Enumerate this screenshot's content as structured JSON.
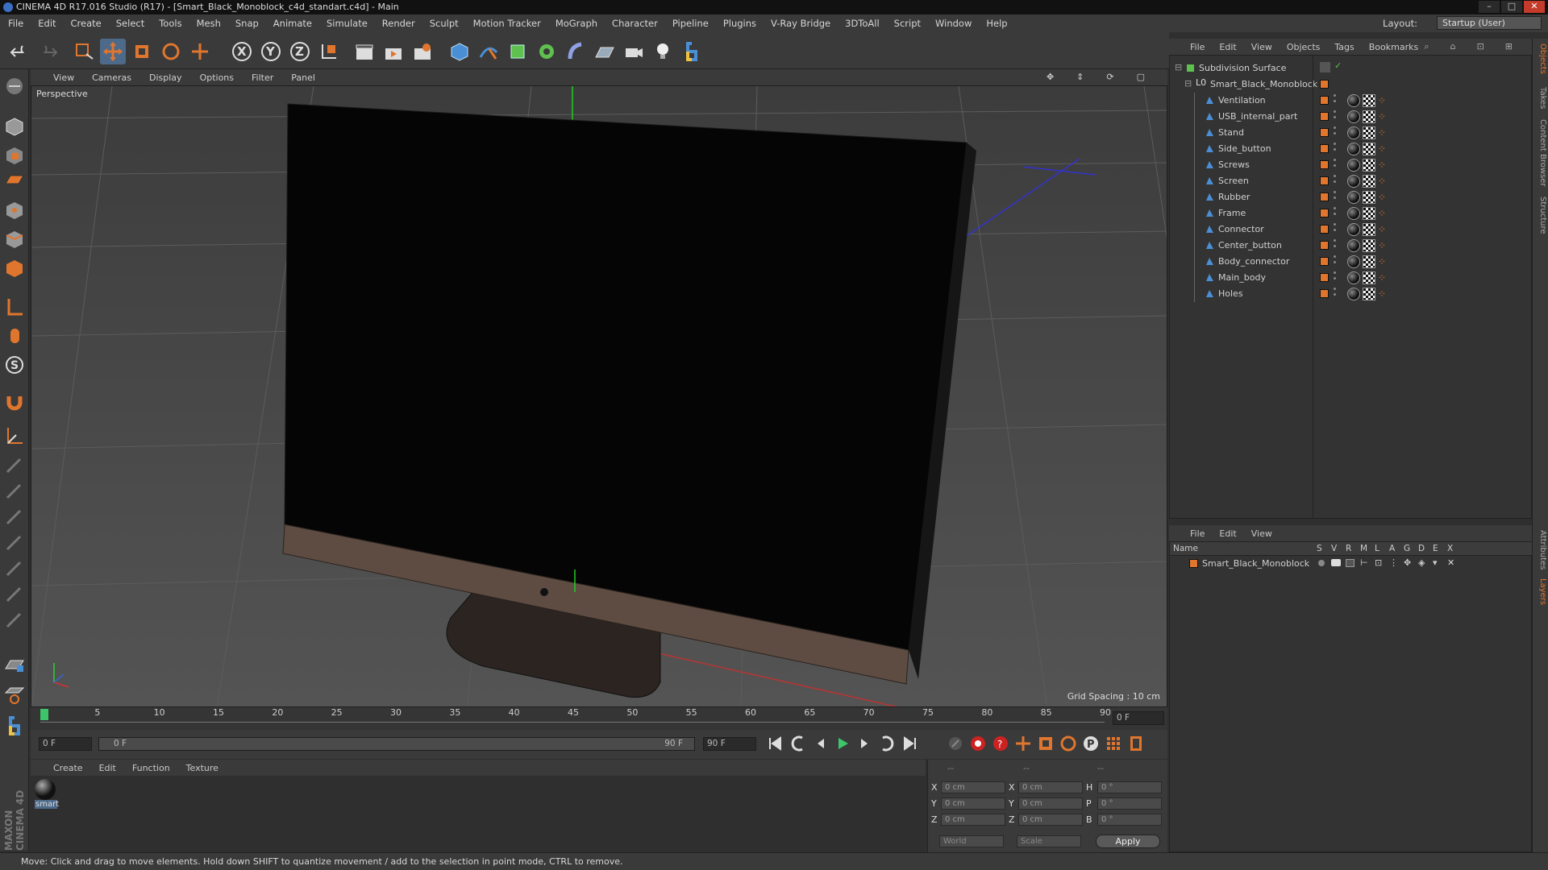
{
  "window": {
    "title": "CINEMA 4D R17.016 Studio (R17) - [Smart_Black_Monoblock_c4d_standart.c4d] - Main"
  },
  "menu": [
    "File",
    "Edit",
    "Create",
    "Select",
    "Tools",
    "Mesh",
    "Snap",
    "Animate",
    "Simulate",
    "Render",
    "Sculpt",
    "Motion Tracker",
    "MoGraph",
    "Character",
    "Pipeline",
    "Plugins",
    "V-Ray Bridge",
    "3DToAll",
    "Script",
    "Window",
    "Help"
  ],
  "layout": {
    "label": "Layout:",
    "value": "Startup (User)"
  },
  "toolbar": {
    "axis_x": "X",
    "axis_y": "Y",
    "axis_z": "Z"
  },
  "viewport": {
    "menu": [
      "View",
      "Cameras",
      "Display",
      "Options",
      "Filter",
      "Panel"
    ],
    "label": "Perspective",
    "grid_spacing": "Grid Spacing : 10 cm"
  },
  "timeline": {
    "ticks": [
      "0",
      "5",
      "10",
      "15",
      "20",
      "25",
      "30",
      "35",
      "40",
      "45",
      "50",
      "55",
      "60",
      "65",
      "70",
      "75",
      "80",
      "85",
      "90"
    ],
    "current_frame": "0 F",
    "start_frame": "0 F",
    "range_start": "0 F",
    "range_end": "90 F",
    "end_frame": "90 F"
  },
  "material_manager": {
    "menu": [
      "Create",
      "Edit",
      "Function",
      "Texture"
    ],
    "materials": [
      {
        "name": "smart"
      }
    ]
  },
  "coordinates": {
    "headers": [
      "--",
      "--",
      "--"
    ],
    "rows": [
      {
        "axis": "X",
        "pos": "0 cm",
        "size_axis": "X",
        "size": "0 cm",
        "rot_axis": "H",
        "rot": "0 °"
      },
      {
        "axis": "Y",
        "pos": "0 cm",
        "size_axis": "Y",
        "size": "0 cm",
        "rot_axis": "P",
        "rot": "0 °"
      },
      {
        "axis": "Z",
        "pos": "0 cm",
        "size_axis": "Z",
        "size": "0 cm",
        "rot_axis": "B",
        "rot": "0 °"
      }
    ],
    "mode": "World",
    "scale": "Scale",
    "apply": "Apply"
  },
  "object_manager": {
    "menu": [
      "File",
      "Edit",
      "View",
      "Objects",
      "Tags",
      "Bookmarks"
    ],
    "root": "Subdivision Surface",
    "group": "Smart_Black_Monoblock",
    "children": [
      "Ventilation",
      "USB_internal_part",
      "Stand",
      "Side_button",
      "Screws",
      "Screen",
      "Rubber",
      "Frame",
      "Connector",
      "Center_button",
      "Body_connector",
      "Main_body",
      "Holes"
    ]
  },
  "layer_manager": {
    "menu": [
      "File",
      "Edit",
      "View"
    ],
    "columns": [
      "Name",
      "S",
      "V",
      "R",
      "M",
      "L",
      "A",
      "G",
      "D",
      "E",
      "X"
    ],
    "layers": [
      "Smart_Black_Monoblock"
    ]
  },
  "side_tabs": [
    "Objects",
    "Takes",
    "Content Browser",
    "Structure",
    "Attributes",
    "Layers"
  ],
  "status": "Move: Click and drag to move elements. Hold down SHIFT to quantize movement / add to the selection in point mode, CTRL to remove.",
  "branding": "MAXON CINEMA 4D",
  "colors": {
    "accent_orange": "#e0762e",
    "tool_blue": "#4a8fd6",
    "object_green": "#5fbf4f"
  }
}
